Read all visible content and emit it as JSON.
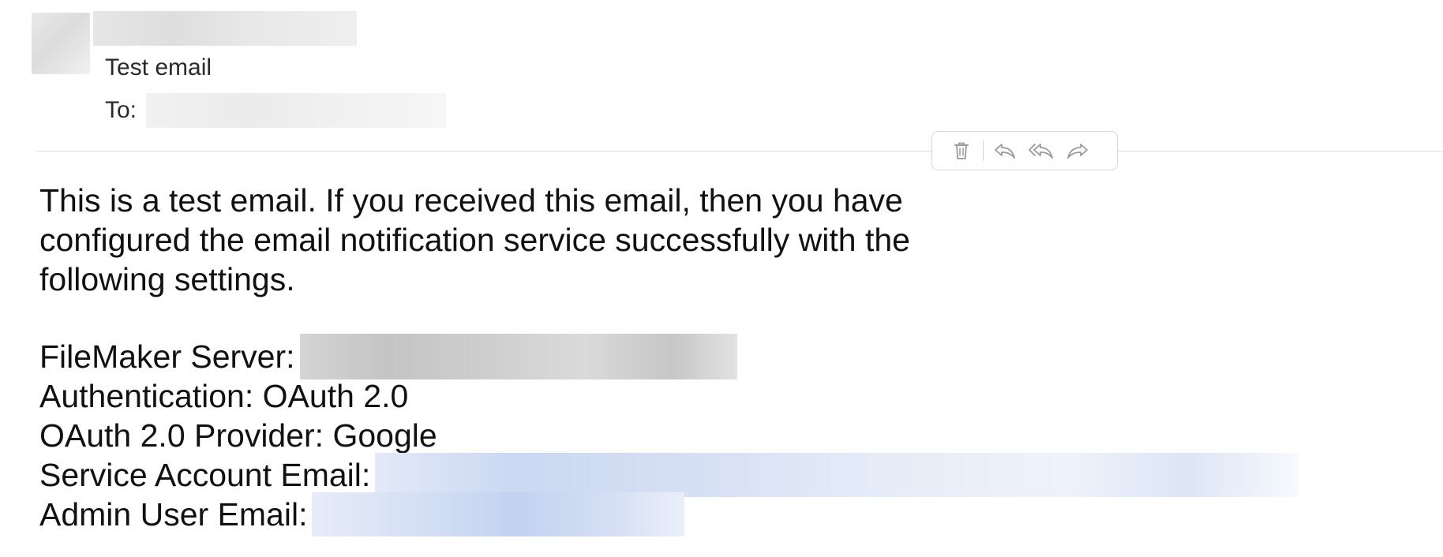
{
  "header": {
    "subject": "Test email",
    "to_label": "To:"
  },
  "toolbar": {
    "buttons": [
      {
        "name": "trash",
        "icon": "trash-icon"
      },
      {
        "name": "reply",
        "icon": "reply-icon"
      },
      {
        "name": "reply-all",
        "icon": "reply-all-icon"
      },
      {
        "name": "forward",
        "icon": "forward-icon"
      }
    ],
    "icon_color": "#9a9a9a"
  },
  "message": {
    "intro": "This is a test email. If you received this email, then you have configured the email notification service successfully with the following settings.",
    "settings": [
      {
        "label": "FileMaker Server:",
        "value": ""
      },
      {
        "label": "Authentication:",
        "value": "OAuth 2.0"
      },
      {
        "label": "OAuth 2.0 Provider:",
        "value": "Google"
      },
      {
        "label": "Service Account Email:",
        "value": ""
      },
      {
        "label": "Admin User Email:",
        "value": ""
      }
    ]
  }
}
